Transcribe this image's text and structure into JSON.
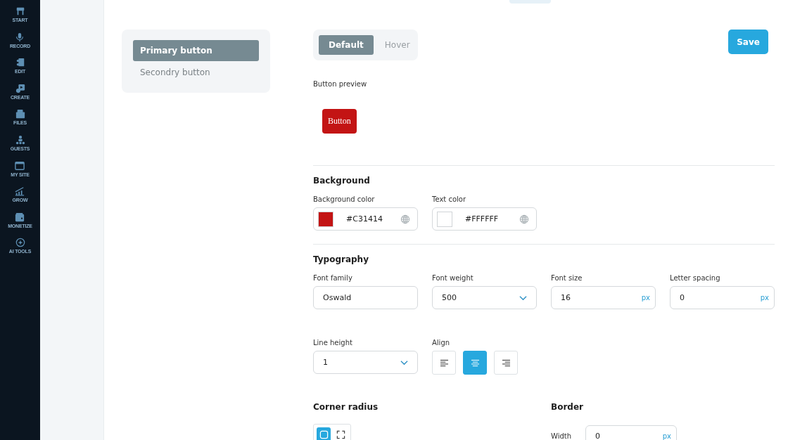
{
  "sidebar": {
    "items": [
      {
        "label": "START"
      },
      {
        "label": "RECORD"
      },
      {
        "label": "EDIT"
      },
      {
        "label": "CREATE"
      },
      {
        "label": "FILES"
      },
      {
        "label": "GUESTS"
      },
      {
        "label": "MY SITE"
      },
      {
        "label": "GROW"
      },
      {
        "label": "MONETIZE"
      },
      {
        "label": "AI TOOLS"
      }
    ]
  },
  "variants": [
    {
      "label": "Primary button",
      "selected": true
    },
    {
      "label": "Secondry button",
      "selected": false
    }
  ],
  "state_tabs": [
    {
      "label": "Default",
      "selected": true
    },
    {
      "label": "Hover",
      "selected": false
    }
  ],
  "save_button": "Save",
  "preview": {
    "label": "Button preview",
    "button": "Button"
  },
  "background": {
    "title": "Background",
    "fields": [
      {
        "label": "Background color",
        "value": "#C31414",
        "color": "#c31414"
      },
      {
        "label": "Text color",
        "value": "#FFFFFF",
        "color": "#ffffff"
      }
    ]
  },
  "typography": {
    "title": "Typography",
    "fields": [
      {
        "kind": "text",
        "label": "Font family",
        "value": "Oswald"
      },
      {
        "kind": "select",
        "label": "Font weight",
        "value": "500"
      },
      {
        "kind": "unit",
        "label": "Font size",
        "value": "16",
        "unit": "px"
      },
      {
        "kind": "unit",
        "label": "Letter spacing",
        "value": "0",
        "unit": "px"
      },
      {
        "kind": "select",
        "label": "Line height",
        "value": "1"
      },
      {
        "kind": "align",
        "label": "Align",
        "options": [
          {
            "kind": "left",
            "selected": false
          },
          {
            "kind": "center",
            "selected": true
          },
          {
            "kind": "right",
            "selected": false
          }
        ]
      }
    ]
  },
  "corner_radius": {
    "title": "Corner radius",
    "options": [
      {
        "kind": "rounded",
        "selected": true
      },
      {
        "kind": "square",
        "selected": false
      }
    ]
  },
  "border": {
    "title": "Border",
    "width": {
      "label": "Width",
      "value": "0",
      "unit": "px"
    }
  }
}
